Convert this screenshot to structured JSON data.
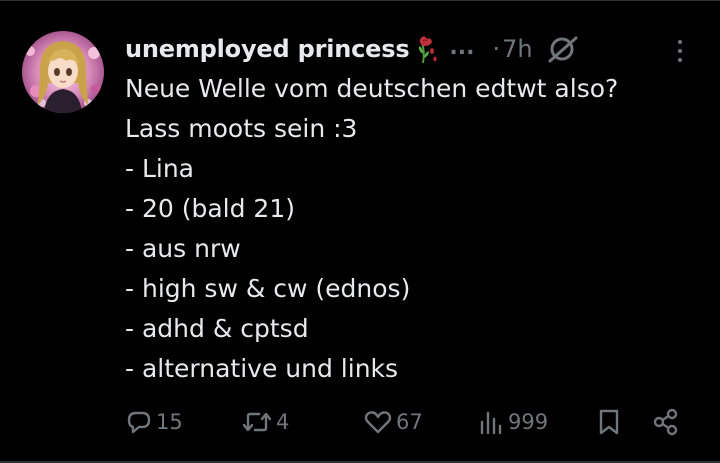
{
  "author": {
    "display_name": "unemployed princess",
    "name_emoji": "wilted-rose-emoji",
    "truncation": "...",
    "separator": "·",
    "timestamp": "7h"
  },
  "tweet": {
    "lines": [
      "Neue Welle vom deutschen edtwt also?",
      "Lass moots sein :3",
      "- Lina",
      "- 20 (bald 21)",
      "- aus nrw",
      "- high sw & cw (ednos)",
      "- adhd & cptsd",
      "- alternative und links"
    ]
  },
  "actions": {
    "reply_count": "15",
    "repost_count": "4",
    "like_count": "67",
    "views_count": "999"
  },
  "icons": {
    "reply": "reply-icon",
    "repost": "repost-icon",
    "like": "heart-icon",
    "views": "views-bar-chart-icon",
    "bookmark": "bookmark-icon",
    "share": "share-icon",
    "mute": "mute-icon",
    "more": "more-options-icon"
  },
  "colors": {
    "background": "#000000",
    "primary_text": "#e7e9ea",
    "secondary_text": "#71767b",
    "divider": "#2f3336"
  }
}
